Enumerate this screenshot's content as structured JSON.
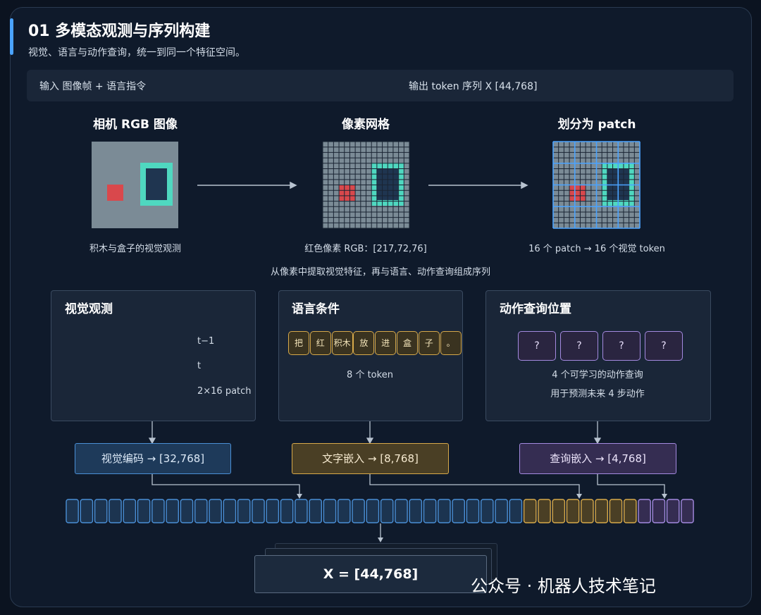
{
  "header": {
    "title": "01 多模态观测与序列构建",
    "subtitle": "视觉、语言与动作查询，统一到同一个特征空间。"
  },
  "io_bar": {
    "input": "输入 图像帧 + 语言指令",
    "output": "输出 token 序列 X [44,768]"
  },
  "stages": [
    {
      "title": "相机 RGB 图像",
      "caption": "积木与盒子的视觉观测"
    },
    {
      "title": "像素网格",
      "caption": "红色像素 RGB：[217,72,76]"
    },
    {
      "title": "划分为 patch",
      "caption": "16 个 patch → 16 个视觉 token"
    }
  ],
  "middle_caption": "从像素中提取视觉特征，再与语言、动作查询组成序列",
  "panels": {
    "vision": {
      "title": "视觉观测",
      "labels": {
        "prev": "t−1",
        "curr": "t",
        "count": "2×16 patch"
      }
    },
    "language": {
      "title": "语言条件",
      "tokens": [
        "把",
        "红",
        "积木",
        "放",
        "进",
        "盒",
        "子",
        "。"
      ],
      "caption": "8 个 token"
    },
    "action": {
      "title": "动作查询位置",
      "queries": [
        "?",
        "?",
        "?",
        "?"
      ],
      "caption_1": "4 个可学习的动作查询",
      "caption_2": "用于预测未来 4 步动作"
    }
  },
  "embeddings": {
    "vision": "视觉编码 → [32,768]",
    "text": "文字嵌入 → [8,768]",
    "query": "查询嵌入 → [4,768]"
  },
  "sequence": {
    "vision_count": 32,
    "text_count": 8,
    "query_count": 4
  },
  "result": "X = [44,768]",
  "watermark": "公众号 · 机器人技术笔记",
  "colors": {
    "accent": "#4aa3ff",
    "vision": "#4a8fd6",
    "text": "#d7a94a",
    "query": "#a48ae0",
    "red_block": "#d9484c",
    "box_teal": "#4fd8c0"
  }
}
